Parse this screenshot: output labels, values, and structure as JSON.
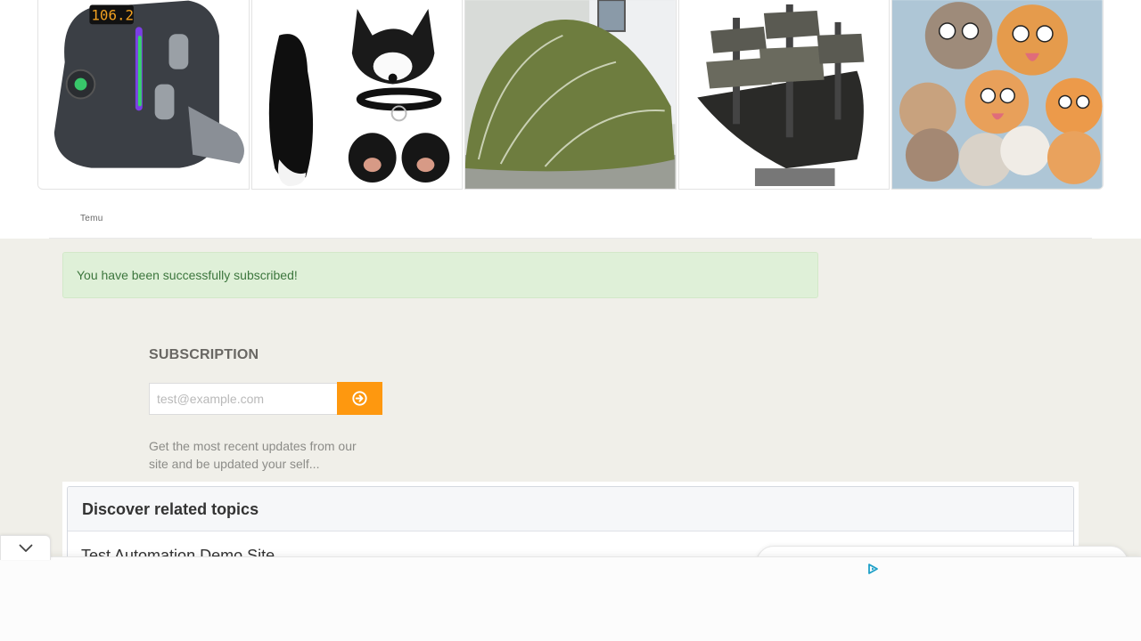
{
  "ad": {
    "brand_label": "Temu",
    "products": [
      {
        "name": "FM transmitter car charger",
        "display_text": "106.2"
      },
      {
        "name": "Fox tail costume set"
      },
      {
        "name": "Green dome tent"
      },
      {
        "name": "Pirate ship model"
      },
      {
        "name": "Funny cats picture"
      }
    ]
  },
  "alert": {
    "message": "You have been successfully subscribed!"
  },
  "subscription": {
    "title": "SUBSCRIPTION",
    "email_placeholder": "test@example.com",
    "email_value": "",
    "description": "Get the most recent updates from our site and be updated your self..."
  },
  "related_topics": {
    "heading": "Discover related topics",
    "items": [
      "Test Automation Demo Site"
    ]
  },
  "colors": {
    "accent_orange": "#fe980f",
    "success_bg": "#dff0d8",
    "success_text": "#3c763d",
    "page_bg": "#f0efe9"
  },
  "icons": {
    "subscribe": "arrow-circle-right-icon",
    "collapse": "chevron-down-icon",
    "adchoices": "adchoices-icon"
  }
}
